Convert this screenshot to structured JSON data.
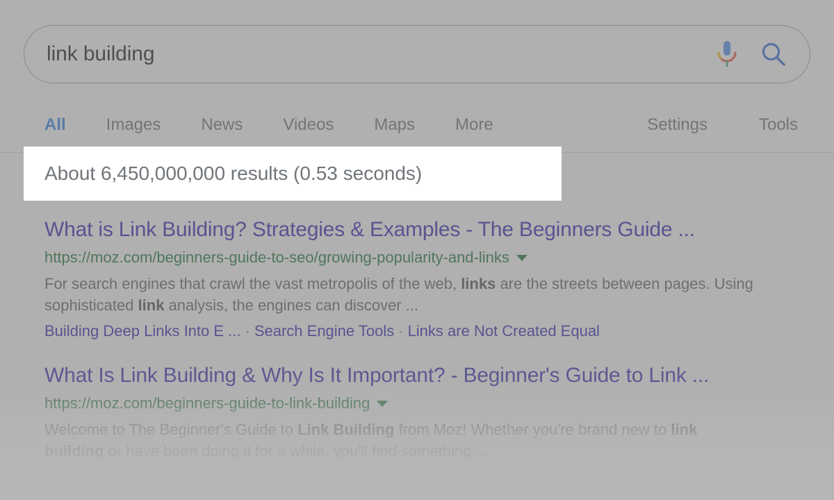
{
  "colors": {
    "accent_blue": "#1a73e8",
    "link_blue": "#1a0dab",
    "url_green": "#006621",
    "snippet_gray": "#4d5156",
    "stats_gray": "#70757a",
    "overlay_gray": "#808080",
    "spotlight_white": "#ffffff",
    "mic_blue": "#4285f4",
    "mic_red": "#ea4335",
    "mic_yellow": "#fbbc05",
    "mic_green": "#34a853"
  },
  "search": {
    "query": "link building",
    "placeholder": "Search",
    "mic_icon": "microphone-icon",
    "search_icon": "search-icon"
  },
  "nav": {
    "left_items": [
      {
        "label": "All",
        "active": true
      },
      {
        "label": "Images",
        "active": false
      },
      {
        "label": "News",
        "active": false
      },
      {
        "label": "Videos",
        "active": false
      },
      {
        "label": "Maps",
        "active": false
      },
      {
        "label": "More",
        "active": false
      }
    ],
    "right_items": [
      {
        "label": "Settings"
      },
      {
        "label": "Tools"
      }
    ]
  },
  "result_stats": "About 6,450,000,000 results (0.53 seconds)",
  "results": [
    {
      "title": "What is Link Building? Strategies & Examples - The Beginners Guide ...",
      "url": "https://moz.com/beginners-guide-to-seo/growing-popularity-and-links",
      "caret_icon": "chevron-down-icon",
      "snippet_parts": [
        {
          "text": "For search engines that crawl the vast metropolis of the web, ",
          "bold": false
        },
        {
          "text": "links",
          "bold": true
        },
        {
          "text": " are the streets between pages. Using sophisticated ",
          "bold": false
        },
        {
          "text": "link",
          "bold": true
        },
        {
          "text": " analysis, the engines can discover ...",
          "bold": false
        }
      ],
      "sitelinks": [
        "Building Deep Links Into E ...",
        "Search Engine Tools",
        "Links are Not Created Equal"
      ],
      "sitelink_separator": "·"
    },
    {
      "title": "What Is Link Building & Why Is It Important? - Beginner's Guide to Link ...",
      "url": "https://moz.com/beginners-guide-to-link-building",
      "caret_icon": "chevron-down-icon",
      "snippet_parts": [
        {
          "text": "Welcome to The Beginner's Guide to ",
          "bold": false
        },
        {
          "text": "Link Building",
          "bold": true
        },
        {
          "text": " from Moz! Whether you're brand new to ",
          "bold": false
        },
        {
          "text": "link building",
          "bold": true
        },
        {
          "text": " or have been doing it for a while, you'll find something ...",
          "bold": false
        }
      ],
      "sitelinks": [],
      "sitelink_separator": "·"
    }
  ]
}
